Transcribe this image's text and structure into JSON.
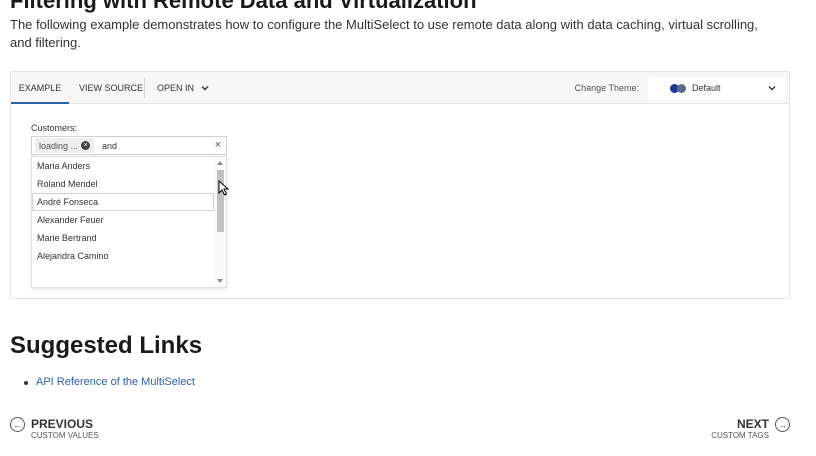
{
  "page": {
    "heading": "Filtering with Remote Data and Virtualization",
    "intro": "The following example demonstrates how to configure the MultiSelect to use remote data along with data caching, virtual scrolling, and filtering."
  },
  "demo": {
    "tabs": {
      "example": "EXAMPLE",
      "view_source": "VIEW SOURCE",
      "open_in": "OPEN IN"
    },
    "theme": {
      "label": "Change Theme:",
      "selected": "Default",
      "dot_colors": [
        "#1f3a93",
        "#5a6b8a"
      ]
    },
    "accent_color": "#2d5fa8",
    "multiselect": {
      "label": "Customers:",
      "chip": "loading ...",
      "typed_text": "and",
      "clear_icon": "close-icon",
      "items": [
        "Maria Anders",
        "Roland Mendel",
        "André Fonseca",
        "Alexander Feuer",
        "Marie Bertrand",
        "Alejandra Camino"
      ],
      "focused_index": 2
    }
  },
  "suggested": {
    "title": "Suggested Links",
    "links": [
      "API Reference of the MultiSelect"
    ]
  },
  "nav": {
    "prev": {
      "title": "PREVIOUS",
      "sub": "CUSTOM VALUES"
    },
    "next": {
      "title": "NEXT",
      "sub": "CUSTOM TAGS"
    }
  }
}
